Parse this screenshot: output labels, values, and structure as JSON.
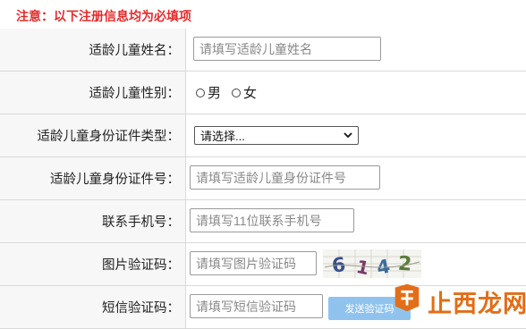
{
  "notice": "注意：以下注册信息均为必填项",
  "fields": [
    {
      "label": "适龄儿童姓名：",
      "placeholder": "请填写适龄儿童姓名"
    },
    {
      "label": "适龄儿童性别：",
      "options": [
        "男",
        "女"
      ]
    },
    {
      "label": "适龄儿童身份证件类型：",
      "selected": "请选择..."
    },
    {
      "label": "适龄儿童身份证件号：",
      "placeholder": "请填写适龄儿童身份证件号"
    },
    {
      "label": "联系手机号：",
      "placeholder": "请填写11位联系手机号"
    },
    {
      "label": "图片验证码：",
      "placeholder": "请填写图片验证码",
      "captcha": [
        "6",
        "1",
        "4",
        "2"
      ]
    },
    {
      "label": "短信验证码：",
      "placeholder": "请填写短信验证码",
      "button": "发送验证码"
    }
  ],
  "watermark": "止西龙网",
  "colors": {
    "notice": "#e52b2b",
    "sms_button": "#8fc3ee",
    "watermark": "#e26e17"
  }
}
